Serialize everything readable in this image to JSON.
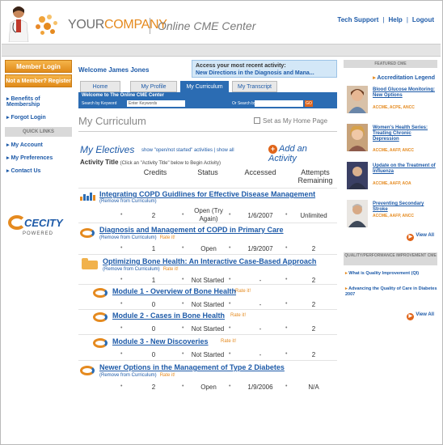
{
  "header": {
    "logo_your": "YOUR",
    "logo_company": "COMPANY",
    "logo_cme": "Online CME Center",
    "links": [
      "Tech Support",
      "Help",
      "Logout"
    ]
  },
  "left": {
    "member_login": "Member Login",
    "register": "Not a Member? Register FREE Now",
    "links": [
      "Benefits of Membership",
      "Forgot Login"
    ],
    "quick_links_title": "QUICK LINKS",
    "quick_links": [
      "My Account",
      "My Preferences",
      "Contact Us"
    ],
    "powered_logo": "CECITY",
    "powered_text": "POWERED"
  },
  "main": {
    "welcome": "Welcome James Jones",
    "recent_title": "Access your most recent activity:",
    "recent_link": "New Directions in the Diagnosis and Mana...",
    "tabs": [
      "Home",
      "My Profile",
      "My Curriculum",
      "My Transcript"
    ],
    "center_bar": "Welcome to The Online CME Center",
    "search_label": "Search by Keyword",
    "search_placeholder": "Enter Keywords",
    "or_search": "Or Search by",
    "go": "GO",
    "page_title": "My Curriculum",
    "set_home": "Set as My Home Page",
    "electives": "My Electives",
    "show_links": "show \"open/not started\" activities | show all",
    "add_activity": "Add an Activity",
    "activity_title": "Activity Title",
    "activity_hint": "(Click an \"Activity Title\" below to Begin Activity)",
    "columns": [
      "Credits",
      "Status",
      "Accessed",
      "Attempts Remaining"
    ]
  },
  "activities": [
    {
      "title": "Integrating COPD Guidlines for Effective Disease Management",
      "sub": "(Remove from Curriculum)",
      "rate": "",
      "credits": "2",
      "status": "Open (Try Again)",
      "accessed": "1/6/2007",
      "attempts": "Unlimited"
    },
    {
      "title": "Diagnosis and Management of COPD in Primary Care",
      "sub": "(Remove from Curriculum)",
      "rate": "Rate it!",
      "credits": "1",
      "status": "Open",
      "accessed": "1/9/2007",
      "attempts": "2"
    },
    {
      "title": "Optimizing Bone Health: An Interactive Case-Based Approach",
      "sub": "(Remove from Curriculum)",
      "rate": "Rate it!",
      "credits": "1",
      "status": "Not Started",
      "accessed": "-",
      "attempts": "2"
    },
    {
      "title": "Module 1 - Overview of Bone Health",
      "sub": "",
      "rate": "Rate it!",
      "credits": "0",
      "status": "Not Started",
      "accessed": "-",
      "attempts": "2"
    },
    {
      "title": "Module 2 - Cases in Bone Health",
      "sub": "",
      "rate": "Rate it!",
      "credits": "0",
      "status": "Not Started",
      "accessed": "-",
      "attempts": "2"
    },
    {
      "title": "Module 3 - New Discoveries",
      "sub": "",
      "rate": "Rate it!",
      "credits": "0",
      "status": "Not Started",
      "accessed": "-",
      "attempts": "2"
    },
    {
      "title": "Newer Options in the Management of Type 2 Diabetes",
      "sub": "(Remove from Curriculum)",
      "rate": "Rate it!",
      "credits": "2",
      "status": "Open",
      "accessed": "1/9/2006",
      "attempts": "N/A"
    }
  ],
  "right": {
    "featured_title": "FEATURED CME",
    "accreditation": "Accreditation Legend",
    "featured": [
      {
        "title": "Blood Glucose Monitoring: New Options",
        "acc": "ACCME, ACPE, ANCC"
      },
      {
        "title": "Women's Health Series: Treating Chronic Depression",
        "acc": "ACCME, AAFP, ANCC"
      },
      {
        "title": "Update on the Treatment of Influenza",
        "acc": "ACCME, AAFP, AOA"
      },
      {
        "title": "Preventing Secondary Stroke",
        "acc": "ACCME, AAFP, ANCC"
      }
    ],
    "view_all": "View All",
    "qi_title": "QUALITY/PERFORMANCE IMPROVEMENT CME",
    "qi_links": [
      "What is Quality Improvement (QI)",
      "Advancing the Quality of Care in Diabetes 2007"
    ],
    "view_all_2": "View All"
  }
}
